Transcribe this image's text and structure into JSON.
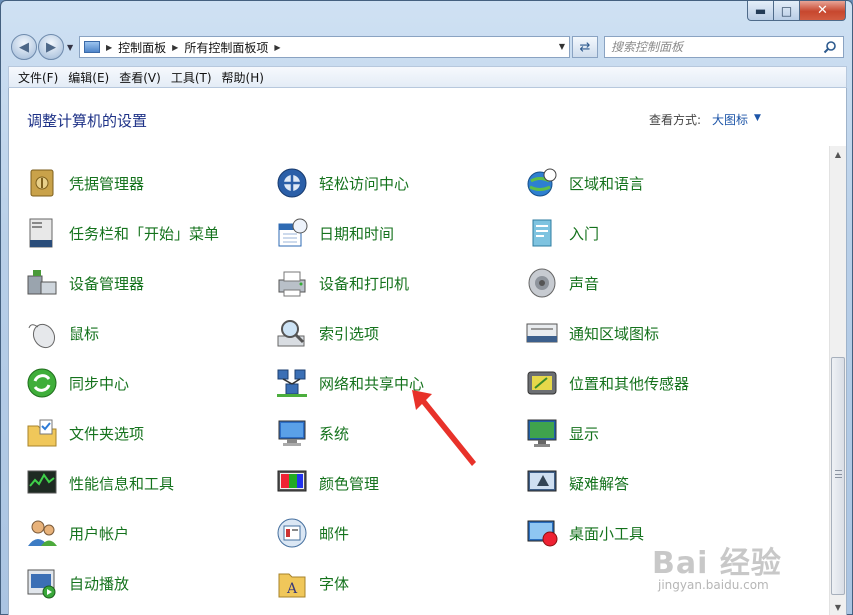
{
  "window": {
    "caption_buttons": {
      "minimize": "▬",
      "maximize": "□",
      "close": "✕"
    }
  },
  "navigation": {
    "address_crumbs": [
      "控制面板",
      "所有控制面板项"
    ],
    "search_placeholder": "搜索控制面板"
  },
  "menubar": {
    "items": [
      "文件(F)",
      "编辑(E)",
      "查看(V)",
      "工具(T)",
      "帮助(H)"
    ]
  },
  "content": {
    "heading": "调整计算机的设置",
    "view_by_label": "查看方式:",
    "view_by_value": "大图标"
  },
  "items": [
    {
      "label": "凭据管理器",
      "icon": "vault-icon"
    },
    {
      "label": "轻松访问中心",
      "icon": "ease-of-access-icon"
    },
    {
      "label": "区域和语言",
      "icon": "globe-clock-icon"
    },
    {
      "label": "任务栏和「开始」菜单",
      "icon": "taskbar-icon"
    },
    {
      "label": "日期和时间",
      "icon": "calendar-clock-icon"
    },
    {
      "label": "入门",
      "icon": "getting-started-icon"
    },
    {
      "label": "设备管理器",
      "icon": "device-manager-icon"
    },
    {
      "label": "设备和打印机",
      "icon": "printer-icon"
    },
    {
      "label": "声音",
      "icon": "speaker-icon"
    },
    {
      "label": "鼠标",
      "icon": "mouse-icon"
    },
    {
      "label": "索引选项",
      "icon": "magnifier-icon"
    },
    {
      "label": "通知区域图标",
      "icon": "notification-area-icon"
    },
    {
      "label": "同步中心",
      "icon": "sync-icon"
    },
    {
      "label": "网络和共享中心",
      "icon": "network-icon"
    },
    {
      "label": "位置和其他传感器",
      "icon": "location-sensor-icon"
    },
    {
      "label": "文件夹选项",
      "icon": "folder-options-icon"
    },
    {
      "label": "系统",
      "icon": "system-icon"
    },
    {
      "label": "显示",
      "icon": "display-icon"
    },
    {
      "label": "性能信息和工具",
      "icon": "performance-icon"
    },
    {
      "label": "颜色管理",
      "icon": "color-management-icon"
    },
    {
      "label": "疑难解答",
      "icon": "troubleshooting-icon"
    },
    {
      "label": "用户帐户",
      "icon": "user-accounts-icon"
    },
    {
      "label": "邮件",
      "icon": "mail-icon"
    },
    {
      "label": "桌面小工具",
      "icon": "gadgets-icon"
    },
    {
      "label": "自动播放",
      "icon": "autoplay-icon"
    },
    {
      "label": "字体",
      "icon": "fonts-icon"
    }
  ],
  "watermark": {
    "main": "Bai 经验",
    "sub": "jingyan.baidu.com"
  },
  "colors": {
    "item_label": "#14721c",
    "heading": "#1e3287",
    "annotation_arrow": "#e8322a"
  }
}
